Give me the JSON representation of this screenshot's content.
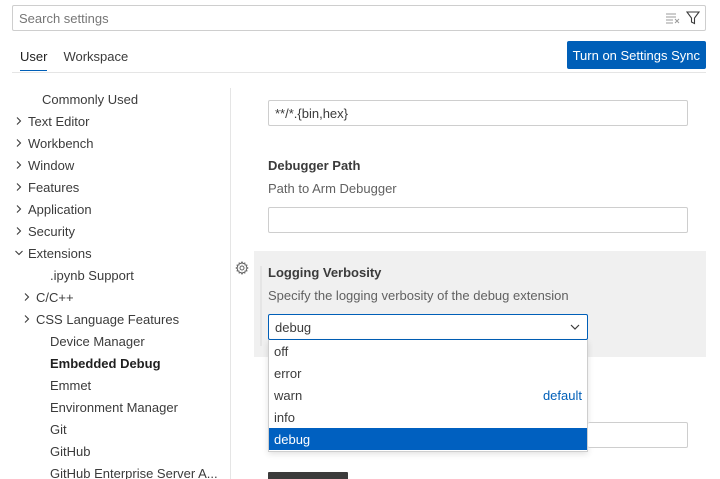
{
  "search": {
    "placeholder": "Search settings",
    "value": ""
  },
  "tabs": [
    {
      "label": "User",
      "active": true
    },
    {
      "label": "Workspace",
      "active": false
    }
  ],
  "sync_button": "Turn on Settings Sync",
  "toc": [
    {
      "label": "Commonly Used",
      "chevron": "none"
    },
    {
      "label": "Text Editor",
      "chevron": "right"
    },
    {
      "label": "Workbench",
      "chevron": "right"
    },
    {
      "label": "Window",
      "chevron": "right"
    },
    {
      "label": "Features",
      "chevron": "right"
    },
    {
      "label": "Application",
      "chevron": "right"
    },
    {
      "label": "Security",
      "chevron": "right"
    },
    {
      "label": "Extensions",
      "chevron": "down"
    },
    {
      "label": ".ipynb Support",
      "chevron": "none",
      "indent": 1
    },
    {
      "label": "C/C++",
      "chevron": "right",
      "indent": 1
    },
    {
      "label": "CSS Language Features",
      "chevron": "right",
      "indent": 1
    },
    {
      "label": "Device Manager",
      "chevron": "none",
      "indent": 1
    },
    {
      "label": "Embedded Debug",
      "chevron": "none",
      "indent": 1,
      "selected": true
    },
    {
      "label": "Emmet",
      "chevron": "none",
      "indent": 1
    },
    {
      "label": "Environment Manager",
      "chevron": "none",
      "indent": 1
    },
    {
      "label": "Git",
      "chevron": "none",
      "indent": 1
    },
    {
      "label": "GitHub",
      "chevron": "none",
      "indent": 1
    },
    {
      "label": "GitHub Enterprise Server A...",
      "chevron": "none",
      "indent": 1
    }
  ],
  "settings": {
    "glob_value": "**/*.{bin,hex}",
    "debugger_path": {
      "title": "Debugger Path",
      "description": "Path to Arm Debugger",
      "value": ""
    },
    "logging_verbosity": {
      "title": "Logging Verbosity",
      "description": "Specify the logging verbosity of the debug extension",
      "value": "debug",
      "options": [
        {
          "label": "off",
          "tag": ""
        },
        {
          "label": "error",
          "tag": ""
        },
        {
          "label": "warn",
          "tag": "default"
        },
        {
          "label": "info",
          "tag": ""
        },
        {
          "label": "debug",
          "tag": ""
        }
      ]
    }
  },
  "colors": {
    "accent": "#005fb8",
    "selected_option": "#0060c0"
  }
}
